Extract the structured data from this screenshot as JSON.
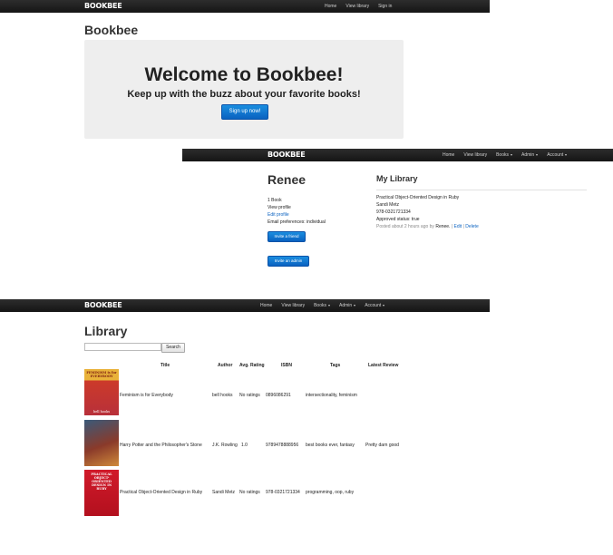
{
  "shot1": {
    "brand": "BOOKBEE",
    "nav": [
      "Home",
      "View library",
      "Sign in"
    ],
    "page_title": "Bookbee",
    "hero_heading": "Welcome to Bookbee!",
    "hero_tagline": "Keep up with the buzz about your favorite books!",
    "signup_button": "Sign up now!"
  },
  "shot2": {
    "brand": "BOOKBEE",
    "nav": [
      "Home",
      "View library",
      "Books",
      "Admin",
      "Account"
    ],
    "user_name": "Renee",
    "book_count": "1 Book",
    "view_profile": "View profile",
    "edit_profile": "Edit profile",
    "email_prefs": "Email preferences: individual",
    "invite_friend": "Invite a friend",
    "invite_admin": "Invite an admin",
    "my_library": "My Library",
    "book_title": "Practical Object-Oriented Design in Ruby",
    "book_author": "Sandi Metz",
    "book_isbn": "978-0321721334",
    "approved": "Approved status: true",
    "posted": "Posted about 2 hours ago by",
    "posted_by": "Renee.",
    "edit_link": "Edit",
    "delete_link": "Delete"
  },
  "shot3": {
    "brand": "BOOKBEE",
    "nav": [
      "Home",
      "View library",
      "Books",
      "Admin",
      "Account"
    ],
    "page_title": "Library",
    "search_button": "Search",
    "search_value": "",
    "columns": [
      "Title",
      "Author",
      "Avg. Rating",
      "ISBN",
      "Tags",
      "Latest Review"
    ],
    "rows": [
      {
        "title": "Feminism is for Everybody",
        "author": "bell hooks",
        "rating": "No ratings",
        "isbn": "0896086291",
        "tags": "intersectionality, feminism",
        "review": "",
        "cover_top": "FEMINISM is for EVERYBODY",
        "cover_bottom": "bell hooks"
      },
      {
        "title": "Harry Potter and the Philosopher's Stone",
        "author": "J.K. Rowling",
        "rating": "1.0",
        "isbn": "9789478888956",
        "tags": "best books ever, fantasy",
        "review": "Pretty darn good",
        "cover_top": "",
        "cover_bottom": ""
      },
      {
        "title": "Practical Object-Oriented Design in Ruby",
        "author": "Sandi Metz",
        "rating": "No ratings",
        "isbn": "978-0321721334",
        "tags": "programming, oop, ruby",
        "review": "",
        "cover_top": "PRACTICAL OBJECT-ORIENTED DESIGN IN RUBY",
        "cover_bottom": ""
      }
    ]
  }
}
